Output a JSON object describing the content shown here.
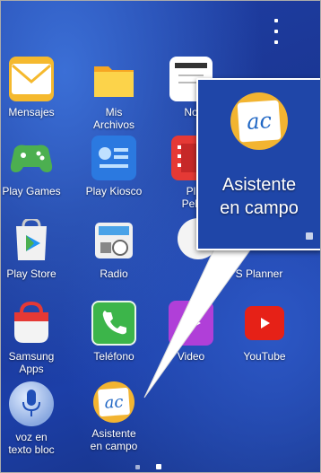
{
  "apps": [
    {
      "label": "Mensajes",
      "icon": "envelope-icon"
    },
    {
      "label": "Mis\nArchivos",
      "icon": "folder-icon"
    },
    {
      "label": "No",
      "icon": "notes-icon"
    },
    {
      "label": "Play Games",
      "icon": "gamepad-icon"
    },
    {
      "label": "Play Kiosco",
      "icon": "newsstand-icon"
    },
    {
      "label": "Pl\nPelí",
      "icon": "film-icon"
    },
    {
      "label": "Play Store",
      "icon": "play-store-icon"
    },
    {
      "label": "Radio",
      "icon": "radio-icon"
    },
    {
      "label": "S Planner",
      "icon": "calendar-icon"
    },
    {
      "label": "Samsung\nApps",
      "icon": "samsung-apps-icon"
    },
    {
      "label": "Teléfono",
      "icon": "phone-icon"
    },
    {
      "label": "Video",
      "icon": "video-icon"
    },
    {
      "label": "YouTube",
      "icon": "youtube-icon"
    },
    {
      "label": "voz en\ntexto bloc",
      "icon": "microphone-icon"
    },
    {
      "label": "Asistente\nen campo",
      "icon": "asistente-icon"
    }
  ],
  "zoom": {
    "label": "Asistente\nen campo",
    "badge_text": "ac"
  },
  "badge_text": "ac",
  "colors": {
    "accent": "#f2b431",
    "background": "#1c3fa8"
  }
}
